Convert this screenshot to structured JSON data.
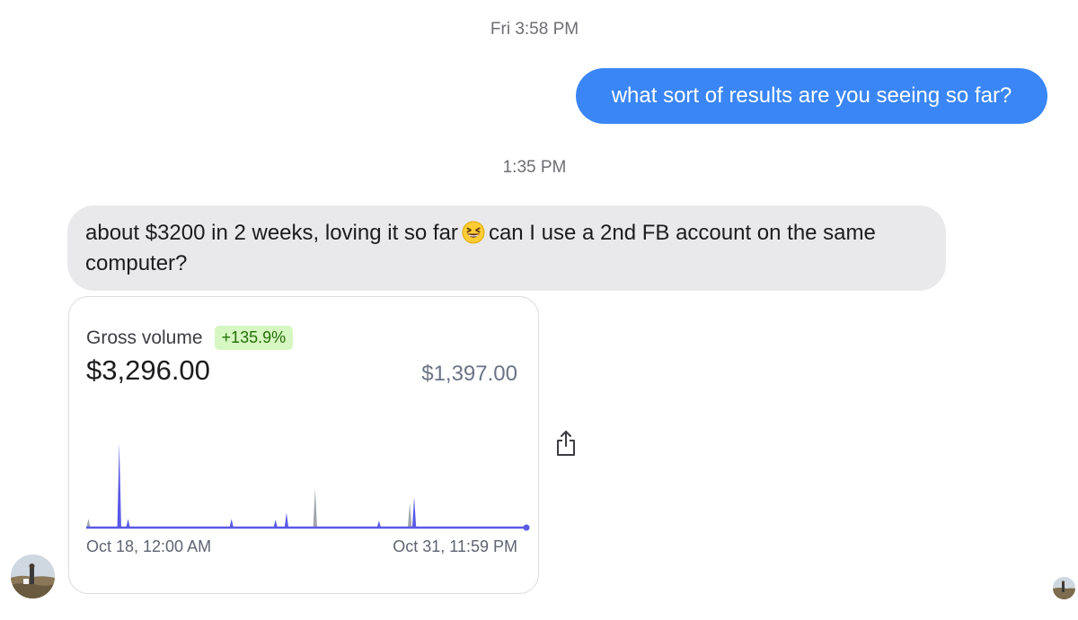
{
  "conversation": {
    "timestamp_1": "Fri 3:58 PM",
    "outgoing_message": "what sort of results are you seeing so far?",
    "timestamp_2": "1:35 PM",
    "incoming_message_part1": "about $3200 in 2 weeks, loving it so far",
    "incoming_emoji": "grinning-squinting-face-emoji",
    "incoming_message_part2": "can I use a 2nd FB account on the same computer?"
  },
  "card": {
    "label": "Gross volume",
    "change_badge": "+135.9%",
    "amount": "$3,296.00",
    "compare_amount": "$1,397.00",
    "date_start": "Oct 18, 12:00 AM",
    "date_end": "Oct 31, 11:59 PM"
  },
  "icons": {
    "share": "share-icon",
    "avatar_left": "avatar",
    "avatar_right": "avatar"
  },
  "colors": {
    "outgoing_bubble": "#3a86f6",
    "incoming_bubble": "#e9e9eb",
    "current_series": "#5a5ae6",
    "previous_series": "#a0a4ab",
    "badge_bg": "#d7f7c2",
    "badge_text": "#217005"
  },
  "chart_data": {
    "type": "area",
    "ylim": [
      0,
      1
    ],
    "series": [
      {
        "name": "",
        "role": "current",
        "spikes": [
          {
            "x": 0.075,
            "value": 0.97
          },
          {
            "x": 0.095,
            "value": 0.1
          },
          {
            "x": 0.33,
            "value": 0.1
          },
          {
            "x": 0.43,
            "value": 0.09
          },
          {
            "x": 0.455,
            "value": 0.17
          },
          {
            "x": 0.665,
            "value": 0.08
          },
          {
            "x": 0.745,
            "value": 0.35
          }
        ]
      },
      {
        "name": "",
        "role": "previous",
        "spikes": [
          {
            "x": 0.005,
            "value": 0.1
          },
          {
            "x": 0.52,
            "value": 0.45
          },
          {
            "x": 0.735,
            "value": 0.28
          }
        ]
      }
    ]
  }
}
